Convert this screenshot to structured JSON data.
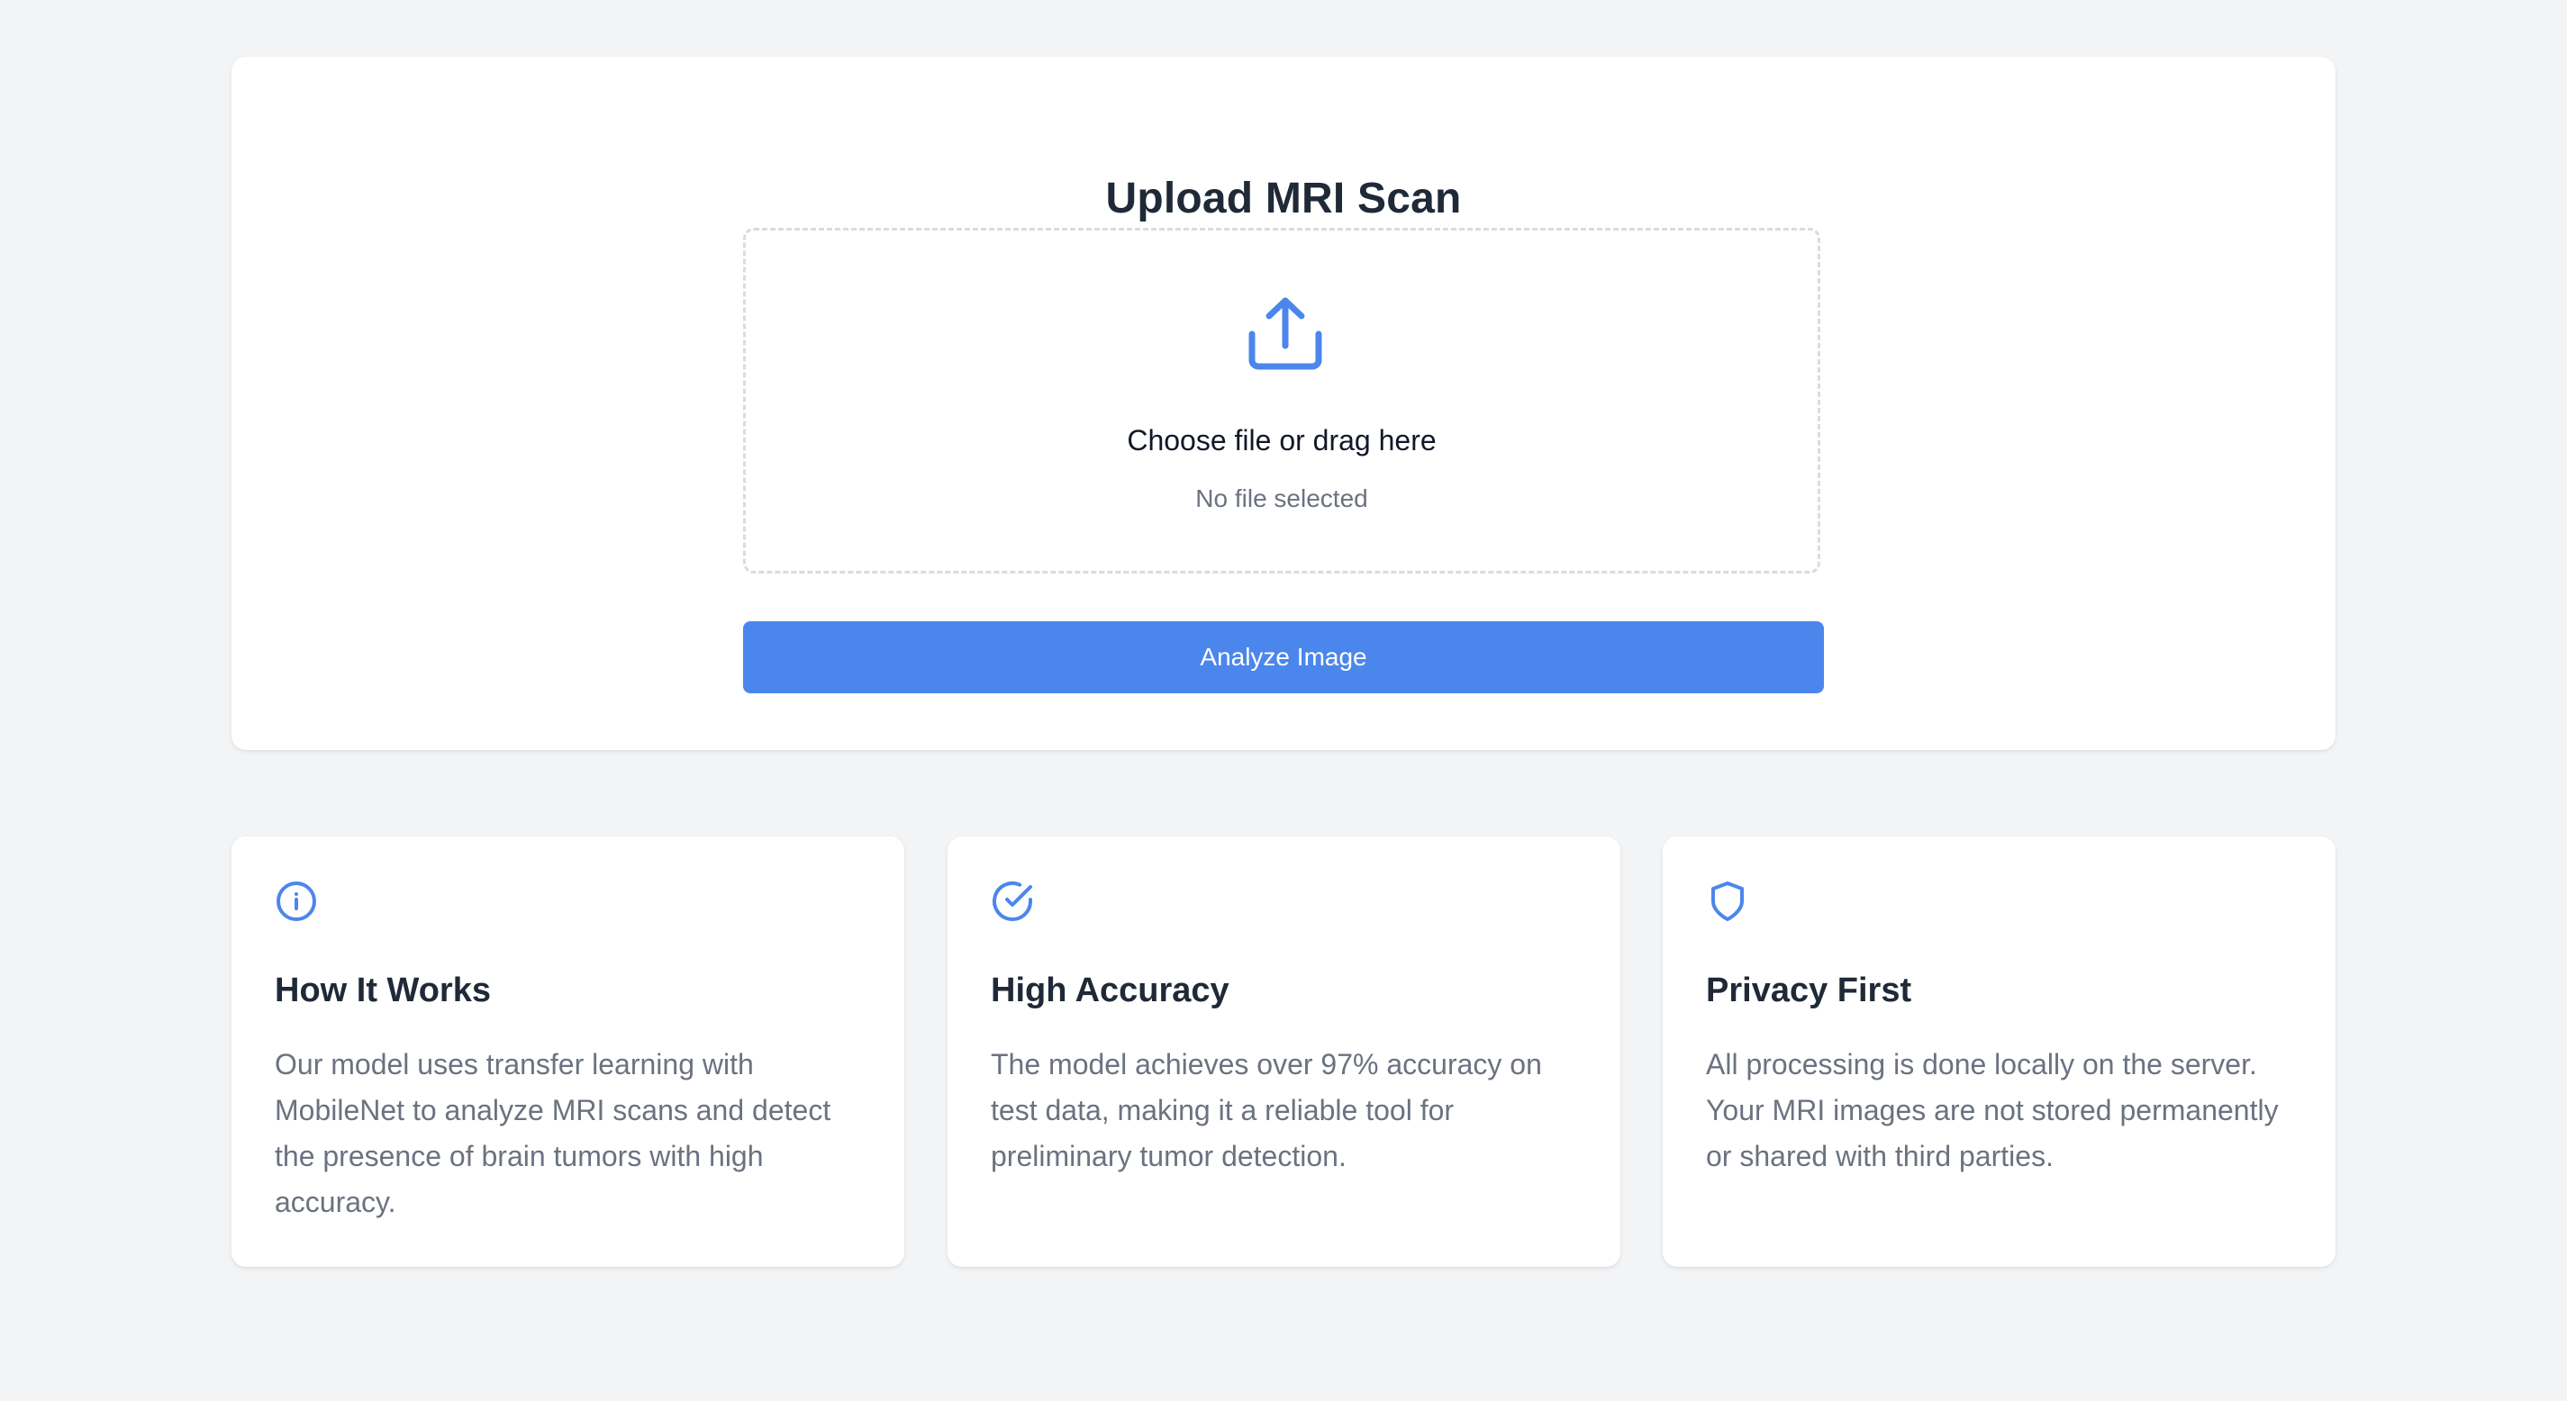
{
  "upload": {
    "title": "Upload MRI Scan",
    "dropzone_label": "Choose file or drag here",
    "file_status": "No file selected",
    "analyze_button": "Analyze Image"
  },
  "features": [
    {
      "icon": "info-icon",
      "title": "How It Works",
      "text": "Our model uses transfer learning with MobileNet to analyze MRI scans and detect the presence of brain tumors with high accuracy."
    },
    {
      "icon": "check-circle-icon",
      "title": "High Accuracy",
      "text": "The model achieves over 97% accuracy on test data, making it a reliable tool for preliminary tumor detection."
    },
    {
      "icon": "shield-icon",
      "title": "Privacy First",
      "text": "All processing is done locally on the server. Your MRI images are not stored permanently or shared with third parties."
    }
  ],
  "colors": {
    "accent": "#4b86ec",
    "background": "#f3f4f6",
    "heading": "#1f2937",
    "muted": "#6b7280"
  }
}
